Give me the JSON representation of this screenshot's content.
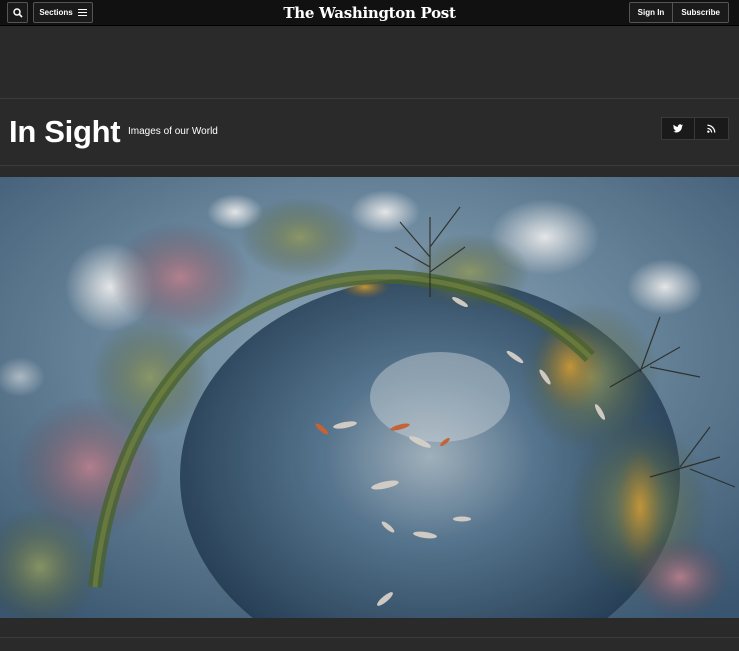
{
  "topbar": {
    "sections_label": "Sections",
    "logo_text": "The Washington Post",
    "signin_label": "Sign In",
    "subscribe_label": "Subscribe",
    "search_icon": "search-icon",
    "menu_icon": "hamburger-icon"
  },
  "header": {
    "title": "In Sight",
    "tagline": "Images of our World",
    "social": [
      {
        "icon": "twitter-icon"
      },
      {
        "icon": "rss-icon"
      }
    ]
  },
  "colors": {
    "page_bg": "#2b2a2b",
    "topbar_bg": "#111111"
  }
}
